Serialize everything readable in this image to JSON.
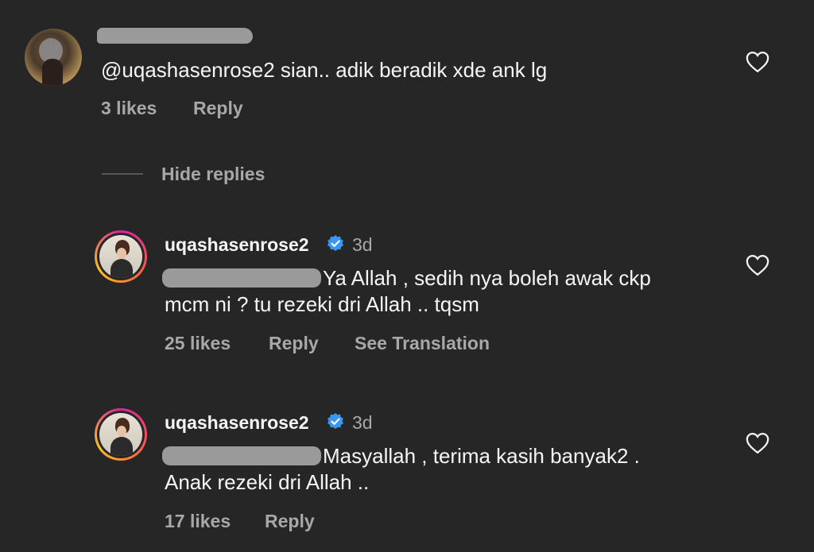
{
  "comments": [
    {
      "text": "@uqashasenrose2 sian.. adik beradik xde ank lg",
      "likes": "3 likes",
      "reply": "Reply"
    }
  ],
  "hide_replies": "Hide replies",
  "replies": [
    {
      "username": "uqashasenrose2",
      "time": "3d",
      "line1": "Ya Allah , sedih nya boleh awak ckp",
      "line2": "mcm ni ? tu rezeki dri Allah .. tqsm",
      "likes": "25 likes",
      "reply": "Reply",
      "translate": "See Translation"
    },
    {
      "username": "uqashasenrose2",
      "time": "3d",
      "line1": "Masyallah , terima kasih banyak2 .",
      "line2": "Anak rezeki dri Allah ..",
      "likes": "17 likes",
      "reply": "Reply"
    }
  ],
  "icons": {
    "heart": "heart-outline-icon",
    "verified": "verified-badge-icon"
  },
  "colors": {
    "background": "#262626",
    "primary_text": "#f5f5f5",
    "secondary_text": "#a8a8a8",
    "verified_blue": "#3897f0"
  }
}
